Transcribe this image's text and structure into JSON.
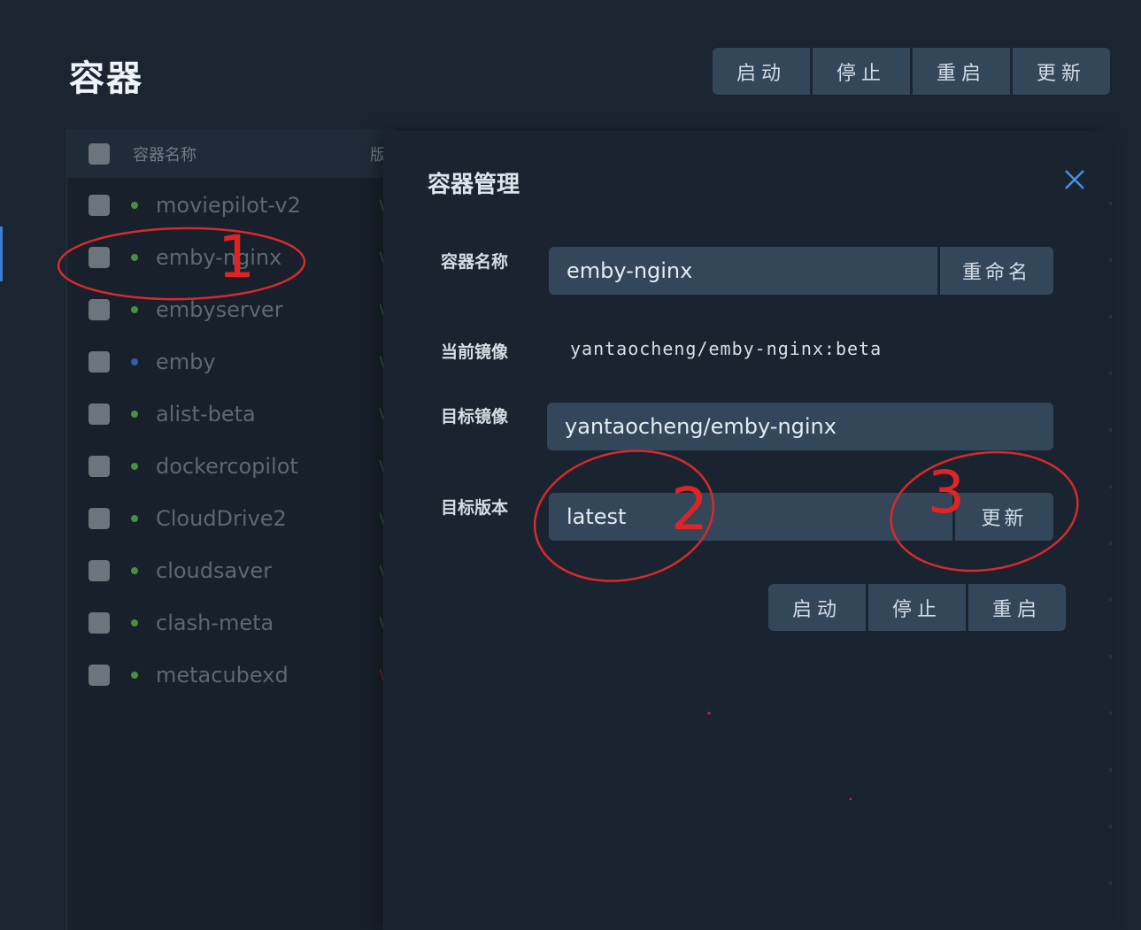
{
  "page": {
    "title": "容器",
    "actions": [
      "启动",
      "停止",
      "重启",
      "更新"
    ]
  },
  "table": {
    "header": {
      "name_col": "容器名称",
      "extra_col": "版"
    },
    "rows": [
      {
        "name": "moviepilot-v2",
        "status_color": "green"
      },
      {
        "name": "emby-nginx",
        "status_color": "green"
      },
      {
        "name": "embyserver",
        "status_color": "green"
      },
      {
        "name": "emby",
        "status_color": "blue"
      },
      {
        "name": "alist-beta",
        "status_color": "green"
      },
      {
        "name": "dockercopilot",
        "status_color": "green"
      },
      {
        "name": "CloudDrive2",
        "status_color": "green"
      },
      {
        "name": "cloudsaver",
        "status_color": "green"
      },
      {
        "name": "clash-meta",
        "status_color": "green"
      },
      {
        "name": "metacubexd",
        "status_color": "green"
      }
    ]
  },
  "dialog": {
    "title": "容器管理",
    "close_icon": "close-icon",
    "fields": {
      "name_label": "容器名称",
      "name_value": "emby-nginx",
      "rename_button": "重命名",
      "current_image_label": "当前镜像",
      "current_image_value": "yantaocheng/emby-nginx:beta",
      "target_image_label": "目标镜像",
      "target_image_value": "yantaocheng/emby-nginx",
      "target_version_label": "目标版本",
      "target_version_value": "latest",
      "update_button": "更新"
    },
    "actions": [
      "启动",
      "停止",
      "重启"
    ]
  },
  "annotations": [
    "1",
    "2",
    "3"
  ],
  "colors": {
    "background": "#1b2531",
    "button": "#34475a",
    "annotation": "#e02424",
    "status_green": "#4a8f3d",
    "status_blue": "#2f5fae"
  }
}
